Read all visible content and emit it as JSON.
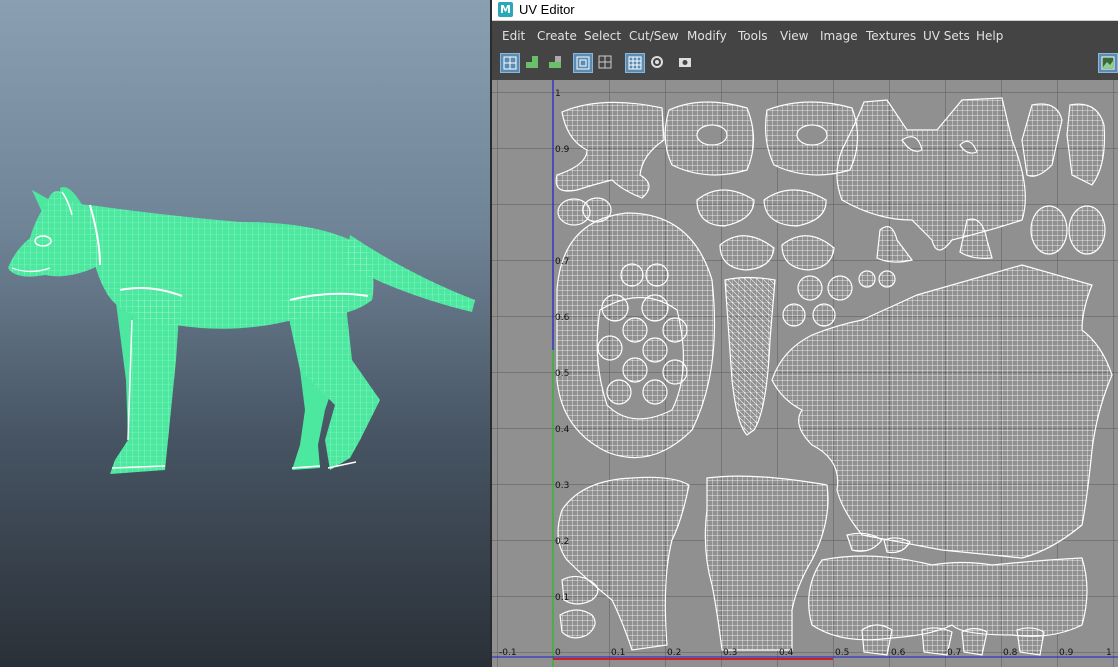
{
  "window": {
    "app_icon_letter": "M",
    "title": "UV Editor"
  },
  "menu": [
    "Edit",
    "Create",
    "Select",
    "Cut/Sew",
    "Modify",
    "Tools",
    "View",
    "Image",
    "Textures",
    "UV Sets",
    "Help"
  ],
  "toolbar": {
    "buttons": [
      {
        "icon": "uv-shell-select-icon",
        "active": true
      },
      {
        "icon": "green-steps-icon",
        "active": false
      },
      {
        "icon": "grey-steps-icon",
        "active": false
      },
      {
        "icon": "frame-icon",
        "active": true
      },
      {
        "icon": "grid-small-icon",
        "active": false
      },
      {
        "icon": "grid-toggle-icon",
        "active": true
      },
      {
        "icon": "gear-icon",
        "active": false
      },
      {
        "icon": "snapshot-icon",
        "active": false
      },
      {
        "icon": "image-display-icon",
        "active": true
      }
    ]
  },
  "uv_grid": {
    "v_ticks": [
      "1",
      "0.9",
      "",
      "0.7",
      "0.6",
      "0.5",
      "0.4",
      "0.3",
      "0.2",
      "0.1"
    ],
    "u_ticks": [
      "-0.1",
      "0",
      "0.1",
      "0.2",
      "0.3",
      "0.4",
      "0.5",
      "0.6",
      "0.7",
      "0.8",
      "0.9",
      "1"
    ],
    "colors": {
      "background": "#909090",
      "grid_line": "#5a5a5a",
      "u_axis": "#d02020",
      "v_axis": "#2020d0",
      "v_axis_lower": "#20c020",
      "wireframe": "#ffffff"
    }
  },
  "viewport": {
    "model": "wolf-mesh",
    "colors": {
      "mesh": "#4de8a0",
      "wire": "#c8ffe4",
      "seam": "#ffffff",
      "background_top": "#8b9fb3",
      "background_bottom": "#2a3037"
    }
  }
}
